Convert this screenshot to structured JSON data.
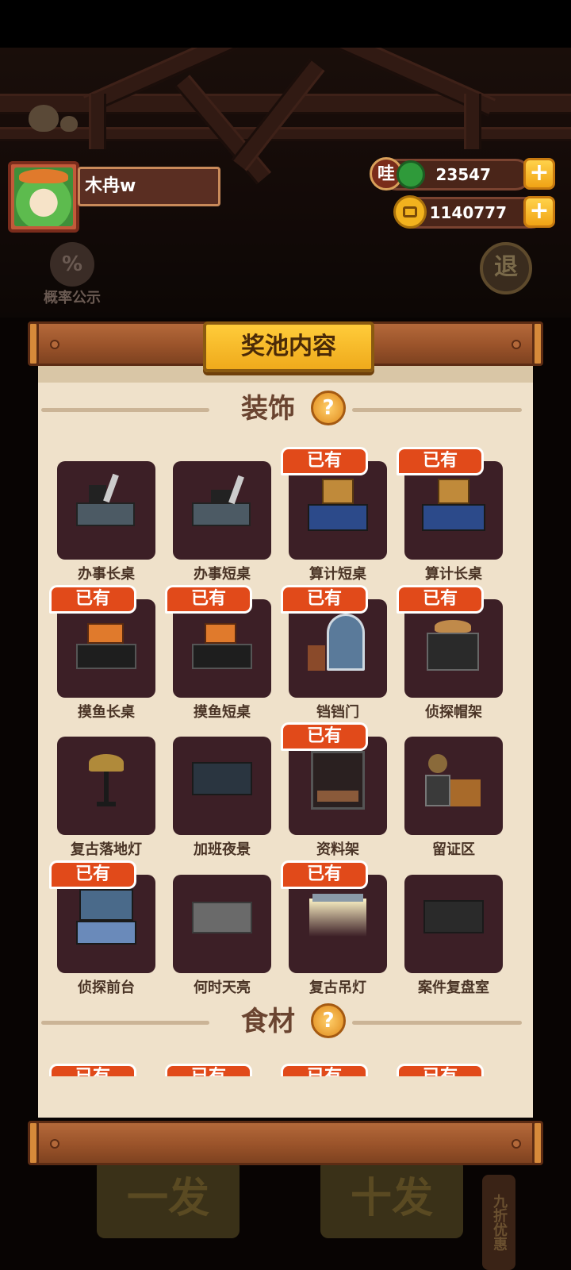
{
  "user": {
    "name": "木冉w"
  },
  "currency": {
    "gems": {
      "icon_label": "哇",
      "value": "23547"
    },
    "coins": {
      "value": "1140777"
    }
  },
  "background": {
    "probability_label": "概率公示",
    "probability_icon": "%",
    "back_label": "退",
    "single_draw_label": "一发",
    "ten_draw_label": "十发",
    "discount_label": "九折优惠"
  },
  "panel": {
    "title": "奖池内容",
    "owned_label": "已有",
    "help_icon": "?",
    "sections": [
      {
        "label": "装饰",
        "items": [
          {
            "name": "办事长桌",
            "owned": false
          },
          {
            "name": "办事短桌",
            "owned": false
          },
          {
            "name": "算计短桌",
            "owned": true
          },
          {
            "name": "算计长桌",
            "owned": true
          },
          {
            "name": "摸鱼长桌",
            "owned": true
          },
          {
            "name": "摸鱼短桌",
            "owned": true
          },
          {
            "name": "铛铛门",
            "owned": true
          },
          {
            "name": "侦探帽架",
            "owned": true
          },
          {
            "name": "复古落地灯",
            "owned": false
          },
          {
            "name": "加班夜景",
            "owned": false
          },
          {
            "name": "资料架",
            "owned": true
          },
          {
            "name": "留证区",
            "owned": false
          },
          {
            "name": "侦探前台",
            "owned": true
          },
          {
            "name": "何时天亮",
            "owned": false
          },
          {
            "name": "复古吊灯",
            "owned": true
          },
          {
            "name": "案件复盘室",
            "owned": false
          }
        ]
      },
      {
        "label": "食材"
      }
    ]
  },
  "colors": {
    "owned_badge": "#e14a1a",
    "tile": "#3c1f26",
    "paper": "#efe1ca",
    "plaque": "#efaa1c"
  }
}
